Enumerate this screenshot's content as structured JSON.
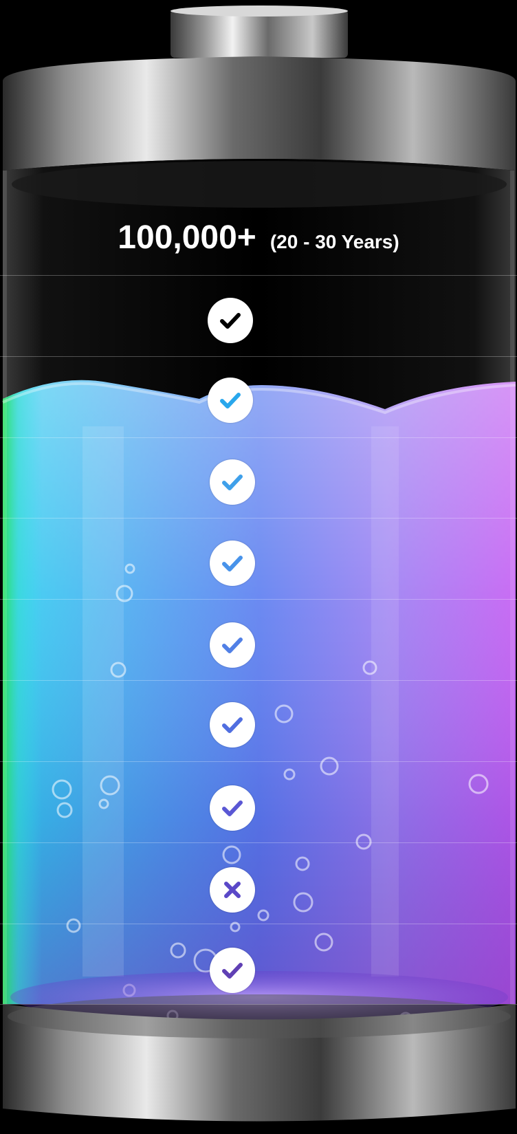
{
  "header": {
    "cycles": "100,000+",
    "lifespan": "(20 - 30 Years)"
  },
  "rows": [
    {
      "status": "check",
      "icon": "check-icon",
      "color": "#000000"
    },
    {
      "status": "check",
      "icon": "check-icon",
      "color": "#29a7ec"
    },
    {
      "status": "check",
      "icon": "check-icon",
      "color": "#3fa0ea"
    },
    {
      "status": "check",
      "icon": "check-icon",
      "color": "#4893ea"
    },
    {
      "status": "check",
      "icon": "check-icon",
      "color": "#5180e6"
    },
    {
      "status": "check",
      "icon": "check-icon",
      "color": "#506ee0"
    },
    {
      "status": "check",
      "icon": "check-icon",
      "color": "#5a57d4"
    },
    {
      "status": "cross",
      "icon": "cross-icon",
      "color": "#5a48c8"
    },
    {
      "status": "check",
      "icon": "check-icon",
      "color": "#6040b4"
    }
  ],
  "colors": {
    "liquid_green": "#32d232",
    "liquid_cyan": "#2fd6ee",
    "liquid_blue": "#4a78f0",
    "liquid_purple": "#b65cf2",
    "background": "#000000",
    "metal": "#8a8a8a"
  }
}
